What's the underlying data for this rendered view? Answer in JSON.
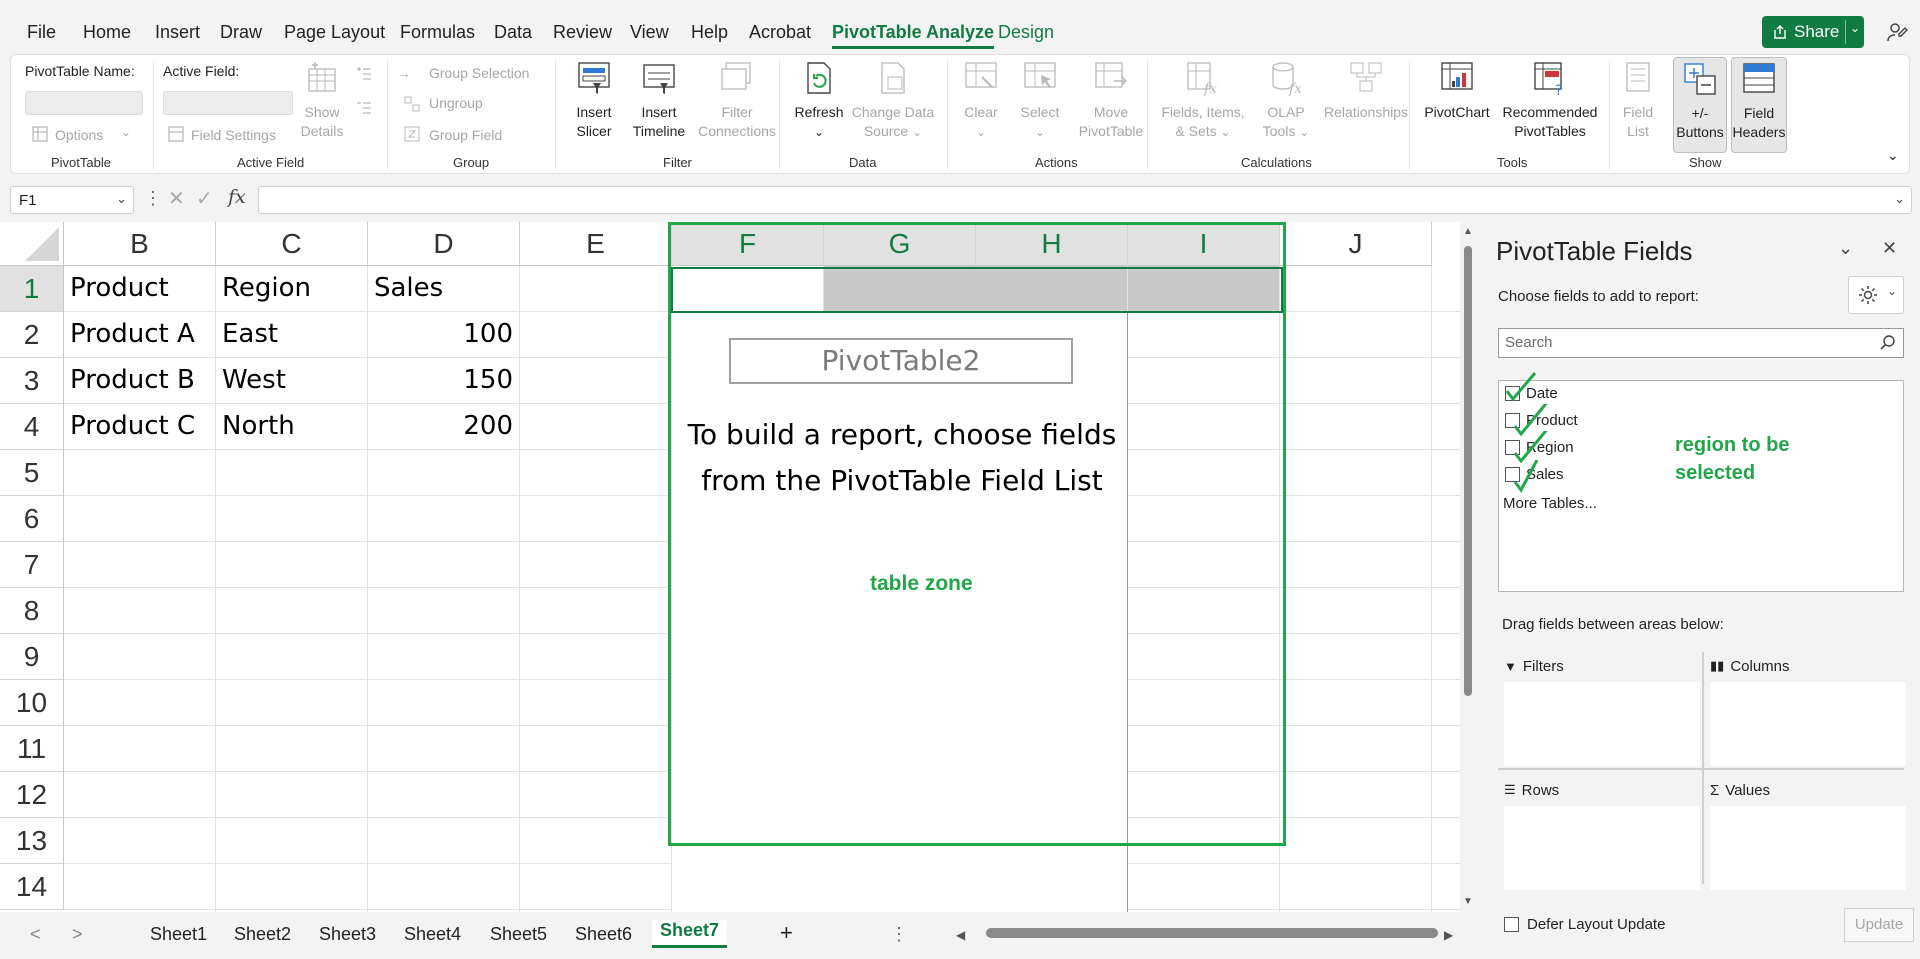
{
  "menu": {
    "items": [
      "File",
      "Home",
      "Insert",
      "Draw",
      "Page Layout",
      "Formulas",
      "Data",
      "Review",
      "View",
      "Help",
      "Acrobat",
      "PivotTable Analyze",
      "Design"
    ],
    "share": "Share"
  },
  "ribbon": {
    "pivottable": {
      "name_label": "PivotTable Name:",
      "options": "Options",
      "group": "PivotTable"
    },
    "active_field": {
      "label": "Active Field:",
      "field_settings": "Field Settings",
      "show_details_1": "Show",
      "show_details_2": "Details",
      "group": "Active Field"
    },
    "group": {
      "group_selection": "Group Selection",
      "ungroup": "Ungroup",
      "group_field": "Group Field",
      "group": "Group"
    },
    "filter": {
      "slicer_1": "Insert",
      "slicer_2": "Slicer",
      "timeline_1": "Insert",
      "timeline_2": "Timeline",
      "connections_1": "Filter",
      "connections_2": "Connections",
      "group": "Filter"
    },
    "data": {
      "refresh": "Refresh",
      "change_source_1": "Change Data",
      "change_source_2": "Source",
      "group": "Data"
    },
    "actions": {
      "clear": "Clear",
      "select": "Select",
      "move_1": "Move",
      "move_2": "PivotTable",
      "group": "Actions"
    },
    "calculations": {
      "fields_1": "Fields, Items,",
      "fields_2": "& Sets",
      "olap_1": "OLAP",
      "olap_2": "Tools",
      "relationships": "Relationships",
      "group": "Calculations"
    },
    "tools": {
      "pivotchart": "PivotChart",
      "recommended_1": "Recommended",
      "recommended_2": "PivotTables",
      "group": "Tools"
    },
    "show": {
      "field_list_1": "Field",
      "field_list_2": "List",
      "buttons_1": "+/-",
      "buttons_2": "Buttons",
      "headers_1": "Field",
      "headers_2": "Headers",
      "group": "Show"
    }
  },
  "formula_bar": {
    "name_box": "F1",
    "fx": "fx"
  },
  "grid": {
    "columns": [
      "B",
      "C",
      "D",
      "E",
      "F",
      "G",
      "H",
      "I",
      "J"
    ],
    "rows": [
      "1",
      "2",
      "3",
      "4",
      "5",
      "6",
      "7",
      "8",
      "9",
      "10",
      "11",
      "12",
      "13",
      "14"
    ],
    "headers": [
      "Product",
      "Region",
      "Sales"
    ],
    "data": [
      [
        "Product A",
        "East",
        "100"
      ],
      [
        "Product B",
        "West",
        "150"
      ],
      [
        "Product C",
        "North",
        "200"
      ]
    ],
    "pivot_title": "PivotTable2",
    "pivot_message": "To build a report, choose fields from the PivotTable Field List",
    "annotation_table_zone": "table zone"
  },
  "sheets": {
    "tabs": [
      "Sheet1",
      "Sheet2",
      "Sheet3",
      "Sheet4",
      "Sheet5",
      "Sheet6",
      "Sheet7"
    ],
    "active": "Sheet7",
    "add": "+"
  },
  "panel": {
    "title": "PivotTable Fields",
    "subtitle": "Choose fields to add to report:",
    "search_placeholder": "Search",
    "fields": [
      "Date",
      "Product",
      "Region",
      "Sales"
    ],
    "more_tables": "More Tables...",
    "annotation_region": "region to be selected",
    "drag_label": "Drag fields between areas below:",
    "areas": {
      "filters": "Filters",
      "columns": "Columns",
      "rows": "Rows",
      "values": "Values"
    },
    "defer": "Defer Layout Update",
    "update": "Update"
  },
  "colors": {
    "accent": "#107c41",
    "annotation": "#21a649"
  }
}
